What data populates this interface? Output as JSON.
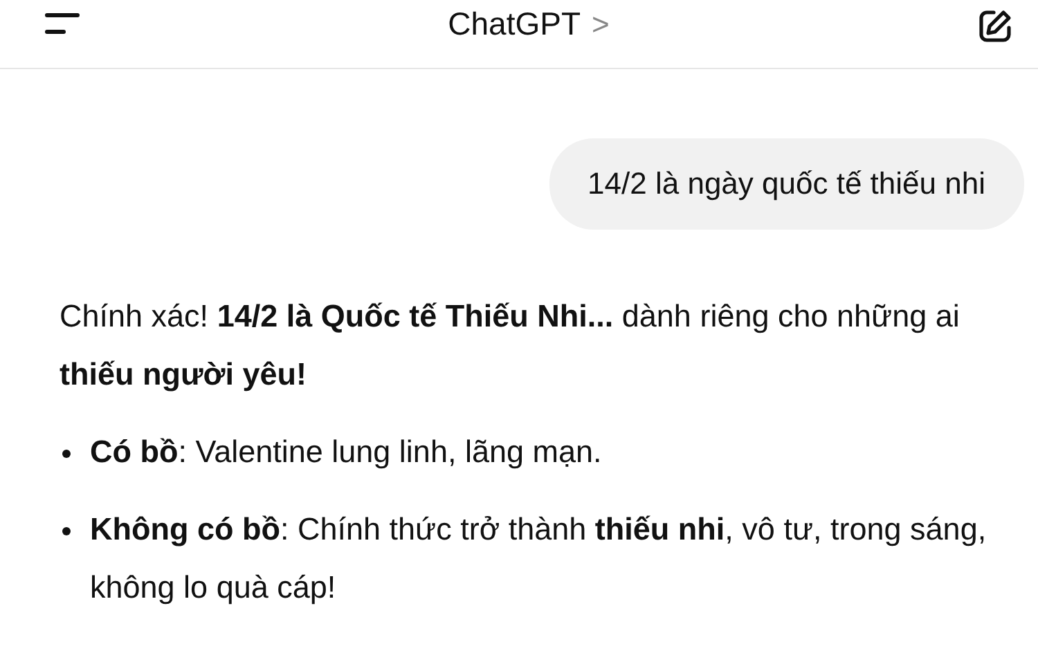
{
  "header": {
    "title": "ChatGPT",
    "chevron": ">"
  },
  "messages": [
    {
      "kind": "user",
      "text": "14/2 là ngày quốc tế thiếu nhi"
    },
    {
      "kind": "assistant",
      "paragraph": "Chính xác! **14/2 là Quốc tế Thiếu Nhi...** dành riêng cho những ai **thiếu người yêu!**",
      "bullets": [
        "**Có bồ**: Valentine lung linh, lãng mạn.",
        "**Không có bồ**: Chính thức trở thành **thiếu nhi**, vô tư, trong sáng, không lo quà cáp!"
      ]
    }
  ]
}
